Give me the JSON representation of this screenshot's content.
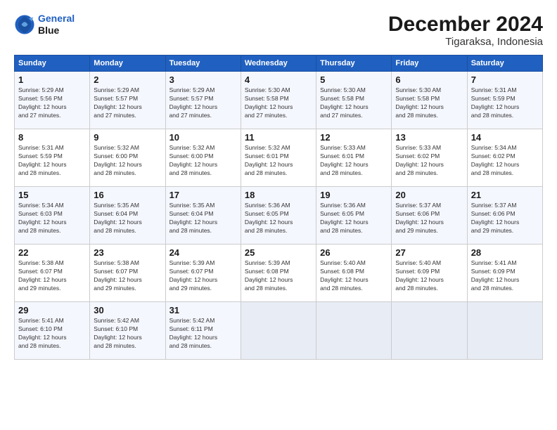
{
  "logo": {
    "line1": "General",
    "line2": "Blue"
  },
  "title": "December 2024",
  "subtitle": "Tigaraksa, Indonesia",
  "weekdays": [
    "Sunday",
    "Monday",
    "Tuesday",
    "Wednesday",
    "Thursday",
    "Friday",
    "Saturday"
  ],
  "weeks": [
    [
      {
        "day": "1",
        "sunrise": "5:29 AM",
        "sunset": "5:56 PM",
        "daylight": "12 hours and 27 minutes."
      },
      {
        "day": "2",
        "sunrise": "5:29 AM",
        "sunset": "5:57 PM",
        "daylight": "12 hours and 27 minutes."
      },
      {
        "day": "3",
        "sunrise": "5:29 AM",
        "sunset": "5:57 PM",
        "daylight": "12 hours and 27 minutes."
      },
      {
        "day": "4",
        "sunrise": "5:30 AM",
        "sunset": "5:58 PM",
        "daylight": "12 hours and 27 minutes."
      },
      {
        "day": "5",
        "sunrise": "5:30 AM",
        "sunset": "5:58 PM",
        "daylight": "12 hours and 27 minutes."
      },
      {
        "day": "6",
        "sunrise": "5:30 AM",
        "sunset": "5:58 PM",
        "daylight": "12 hours and 28 minutes."
      },
      {
        "day": "7",
        "sunrise": "5:31 AM",
        "sunset": "5:59 PM",
        "daylight": "12 hours and 28 minutes."
      }
    ],
    [
      {
        "day": "8",
        "sunrise": "5:31 AM",
        "sunset": "5:59 PM",
        "daylight": "12 hours and 28 minutes."
      },
      {
        "day": "9",
        "sunrise": "5:32 AM",
        "sunset": "6:00 PM",
        "daylight": "12 hours and 28 minutes."
      },
      {
        "day": "10",
        "sunrise": "5:32 AM",
        "sunset": "6:00 PM",
        "daylight": "12 hours and 28 minutes."
      },
      {
        "day": "11",
        "sunrise": "5:32 AM",
        "sunset": "6:01 PM",
        "daylight": "12 hours and 28 minutes."
      },
      {
        "day": "12",
        "sunrise": "5:33 AM",
        "sunset": "6:01 PM",
        "daylight": "12 hours and 28 minutes."
      },
      {
        "day": "13",
        "sunrise": "5:33 AM",
        "sunset": "6:02 PM",
        "daylight": "12 hours and 28 minutes."
      },
      {
        "day": "14",
        "sunrise": "5:34 AM",
        "sunset": "6:02 PM",
        "daylight": "12 hours and 28 minutes."
      }
    ],
    [
      {
        "day": "15",
        "sunrise": "5:34 AM",
        "sunset": "6:03 PM",
        "daylight": "12 hours and 28 minutes."
      },
      {
        "day": "16",
        "sunrise": "5:35 AM",
        "sunset": "6:04 PM",
        "daylight": "12 hours and 28 minutes."
      },
      {
        "day": "17",
        "sunrise": "5:35 AM",
        "sunset": "6:04 PM",
        "daylight": "12 hours and 28 minutes."
      },
      {
        "day": "18",
        "sunrise": "5:36 AM",
        "sunset": "6:05 PM",
        "daylight": "12 hours and 28 minutes."
      },
      {
        "day": "19",
        "sunrise": "5:36 AM",
        "sunset": "6:05 PM",
        "daylight": "12 hours and 28 minutes."
      },
      {
        "day": "20",
        "sunrise": "5:37 AM",
        "sunset": "6:06 PM",
        "daylight": "12 hours and 29 minutes."
      },
      {
        "day": "21",
        "sunrise": "5:37 AM",
        "sunset": "6:06 PM",
        "daylight": "12 hours and 29 minutes."
      }
    ],
    [
      {
        "day": "22",
        "sunrise": "5:38 AM",
        "sunset": "6:07 PM",
        "daylight": "12 hours and 29 minutes."
      },
      {
        "day": "23",
        "sunrise": "5:38 AM",
        "sunset": "6:07 PM",
        "daylight": "12 hours and 29 minutes."
      },
      {
        "day": "24",
        "sunrise": "5:39 AM",
        "sunset": "6:07 PM",
        "daylight": "12 hours and 29 minutes."
      },
      {
        "day": "25",
        "sunrise": "5:39 AM",
        "sunset": "6:08 PM",
        "daylight": "12 hours and 28 minutes."
      },
      {
        "day": "26",
        "sunrise": "5:40 AM",
        "sunset": "6:08 PM",
        "daylight": "12 hours and 28 minutes."
      },
      {
        "day": "27",
        "sunrise": "5:40 AM",
        "sunset": "6:09 PM",
        "daylight": "12 hours and 28 minutes."
      },
      {
        "day": "28",
        "sunrise": "5:41 AM",
        "sunset": "6:09 PM",
        "daylight": "12 hours and 28 minutes."
      }
    ],
    [
      {
        "day": "29",
        "sunrise": "5:41 AM",
        "sunset": "6:10 PM",
        "daylight": "12 hours and 28 minutes."
      },
      {
        "day": "30",
        "sunrise": "5:42 AM",
        "sunset": "6:10 PM",
        "daylight": "12 hours and 28 minutes."
      },
      {
        "day": "31",
        "sunrise": "5:42 AM",
        "sunset": "6:11 PM",
        "daylight": "12 hours and 28 minutes."
      },
      null,
      null,
      null,
      null
    ]
  ],
  "labels": {
    "sunrise": "Sunrise:",
    "sunset": "Sunset:",
    "daylight": "Daylight:"
  }
}
